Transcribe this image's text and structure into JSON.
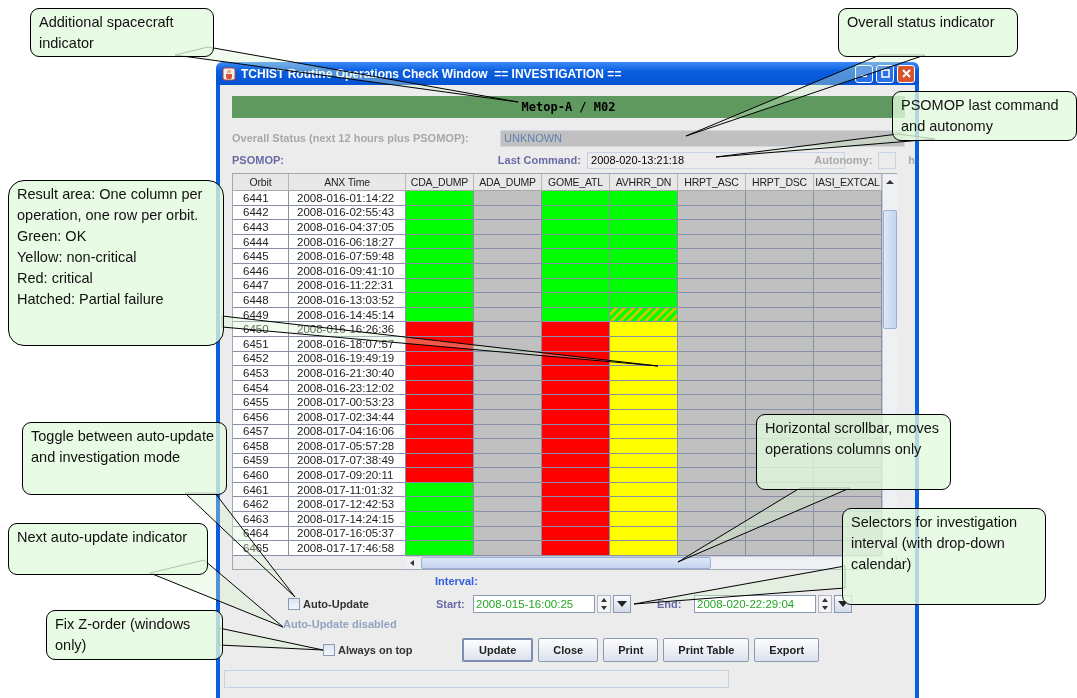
{
  "window": {
    "title": "TCHIST Routine Operations Check Window  == INVESTIGATION =="
  },
  "spacecraft": "Metop-A / M02",
  "overall_status": {
    "label": "Overall Status (next 12 hours plus PSOMOP):",
    "value": "UNKNOWN"
  },
  "psomop": {
    "label": "PSOMOP:",
    "last_command_label": "Last Command:",
    "last_command": "2008-020-13:21:18",
    "autonomy_label": "Autonomy:",
    "autonomy_unit": "h"
  },
  "table": {
    "columns": [
      "Orbit",
      "ANX Time",
      "CDA_DUMP",
      "ADA_DUMP",
      "GOME_ATL",
      "AVHRR_DN",
      "HRPT_ASC",
      "HRPT_DSC",
      "IASI_EXTCAL"
    ],
    "rows": [
      {
        "orbit": "6441",
        "anx_time": "2008-016-01:14:22",
        "cells": [
          {
            "kind": "ok"
          },
          {
            "kind": "none"
          },
          {
            "kind": "ok"
          },
          {
            "kind": "ok"
          },
          {
            "kind": "none"
          },
          {
            "kind": "none"
          },
          {
            "kind": "none"
          }
        ]
      },
      {
        "orbit": "6442",
        "anx_time": "2008-016-02:55:43",
        "cells": [
          {
            "kind": "ok"
          },
          {
            "kind": "none"
          },
          {
            "kind": "ok"
          },
          {
            "kind": "ok"
          },
          {
            "kind": "none"
          },
          {
            "kind": "none"
          },
          {
            "kind": "none"
          }
        ]
      },
      {
        "orbit": "6443",
        "anx_time": "2008-016-04:37:05",
        "cells": [
          {
            "kind": "ok"
          },
          {
            "kind": "none"
          },
          {
            "kind": "ok"
          },
          {
            "kind": "ok"
          },
          {
            "kind": "none"
          },
          {
            "kind": "none"
          },
          {
            "kind": "none"
          }
        ]
      },
      {
        "orbit": "6444",
        "anx_time": "2008-016-06:18:27",
        "cells": [
          {
            "kind": "ok"
          },
          {
            "kind": "none"
          },
          {
            "kind": "ok"
          },
          {
            "kind": "ok"
          },
          {
            "kind": "none"
          },
          {
            "kind": "none"
          },
          {
            "kind": "none"
          }
        ]
      },
      {
        "orbit": "6445",
        "anx_time": "2008-016-07:59:48",
        "cells": [
          {
            "kind": "ok"
          },
          {
            "kind": "none"
          },
          {
            "kind": "ok"
          },
          {
            "kind": "ok"
          },
          {
            "kind": "none"
          },
          {
            "kind": "none"
          },
          {
            "kind": "none"
          }
        ]
      },
      {
        "orbit": "6446",
        "anx_time": "2008-016-09:41:10",
        "cells": [
          {
            "kind": "ok"
          },
          {
            "kind": "none"
          },
          {
            "kind": "ok"
          },
          {
            "kind": "ok"
          },
          {
            "kind": "none"
          },
          {
            "kind": "none"
          },
          {
            "kind": "none"
          }
        ]
      },
      {
        "orbit": "6447",
        "anx_time": "2008-016-11:22:31",
        "cells": [
          {
            "kind": "ok"
          },
          {
            "kind": "none"
          },
          {
            "kind": "ok"
          },
          {
            "kind": "ok"
          },
          {
            "kind": "none"
          },
          {
            "kind": "none"
          },
          {
            "kind": "none"
          }
        ]
      },
      {
        "orbit": "6448",
        "anx_time": "2008-016-13:03:52",
        "cells": [
          {
            "kind": "ok"
          },
          {
            "kind": "none"
          },
          {
            "kind": "ok"
          },
          {
            "kind": "ok"
          },
          {
            "kind": "none"
          },
          {
            "kind": "none"
          },
          {
            "kind": "none"
          }
        ]
      },
      {
        "orbit": "6449",
        "anx_time": "2008-016-14:45:14",
        "cells": [
          {
            "kind": "ok"
          },
          {
            "kind": "none"
          },
          {
            "kind": "ok"
          },
          {
            "kind": "partial"
          },
          {
            "kind": "none"
          },
          {
            "kind": "none"
          },
          {
            "kind": "none"
          }
        ]
      },
      {
        "orbit": "6450",
        "anx_time": "2008-016-16:26:36",
        "cells": [
          {
            "kind": "critical"
          },
          {
            "kind": "none"
          },
          {
            "kind": "critical"
          },
          {
            "kind": "warning"
          },
          {
            "kind": "none"
          },
          {
            "kind": "none"
          },
          {
            "kind": "none"
          }
        ]
      },
      {
        "orbit": "6451",
        "anx_time": "2008-016-18:07:57",
        "cells": [
          {
            "kind": "critical"
          },
          {
            "kind": "none"
          },
          {
            "kind": "critical"
          },
          {
            "kind": "warning"
          },
          {
            "kind": "none"
          },
          {
            "kind": "none"
          },
          {
            "kind": "none"
          }
        ]
      },
      {
        "orbit": "6452",
        "anx_time": "2008-016-19:49:19",
        "cells": [
          {
            "kind": "critical"
          },
          {
            "kind": "none"
          },
          {
            "kind": "critical"
          },
          {
            "kind": "warning"
          },
          {
            "kind": "none"
          },
          {
            "kind": "none"
          },
          {
            "kind": "none"
          }
        ]
      },
      {
        "orbit": "6453",
        "anx_time": "2008-016-21:30:40",
        "cells": [
          {
            "kind": "critical"
          },
          {
            "kind": "none"
          },
          {
            "kind": "critical"
          },
          {
            "kind": "warning"
          },
          {
            "kind": "none"
          },
          {
            "kind": "none"
          },
          {
            "kind": "none"
          }
        ]
      },
      {
        "orbit": "6454",
        "anx_time": "2008-016-23:12:02",
        "cells": [
          {
            "kind": "critical"
          },
          {
            "kind": "none"
          },
          {
            "kind": "critical"
          },
          {
            "kind": "warning"
          },
          {
            "kind": "none"
          },
          {
            "kind": "none"
          },
          {
            "kind": "none"
          }
        ]
      },
      {
        "orbit": "6455",
        "anx_time": "2008-017-00:53:23",
        "cells": [
          {
            "kind": "critical"
          },
          {
            "kind": "none"
          },
          {
            "kind": "critical"
          },
          {
            "kind": "warning"
          },
          {
            "kind": "none"
          },
          {
            "kind": "none"
          },
          {
            "kind": "none"
          }
        ]
      },
      {
        "orbit": "6456",
        "anx_time": "2008-017-02:34:44",
        "cells": [
          {
            "kind": "critical"
          },
          {
            "kind": "none"
          },
          {
            "kind": "critical"
          },
          {
            "kind": "warning"
          },
          {
            "kind": "none"
          },
          {
            "kind": "none"
          },
          {
            "kind": "none"
          }
        ]
      },
      {
        "orbit": "6457",
        "anx_time": "2008-017-04:16:06",
        "cells": [
          {
            "kind": "critical"
          },
          {
            "kind": "none"
          },
          {
            "kind": "critical"
          },
          {
            "kind": "warning"
          },
          {
            "kind": "none"
          },
          {
            "kind": "none"
          },
          {
            "kind": "none"
          }
        ]
      },
      {
        "orbit": "6458",
        "anx_time": "2008-017-05:57:28",
        "cells": [
          {
            "kind": "critical"
          },
          {
            "kind": "none"
          },
          {
            "kind": "critical"
          },
          {
            "kind": "warning"
          },
          {
            "kind": "none"
          },
          {
            "kind": "none"
          },
          {
            "kind": "none"
          }
        ]
      },
      {
        "orbit": "6459",
        "anx_time": "2008-017-07:38:49",
        "cells": [
          {
            "kind": "critical"
          },
          {
            "kind": "none"
          },
          {
            "kind": "critical"
          },
          {
            "kind": "warning"
          },
          {
            "kind": "none"
          },
          {
            "kind": "none"
          },
          {
            "kind": "none"
          }
        ]
      },
      {
        "orbit": "6460",
        "anx_time": "2008-017-09:20:11",
        "cells": [
          {
            "kind": "critical"
          },
          {
            "kind": "none"
          },
          {
            "kind": "critical"
          },
          {
            "kind": "warning"
          },
          {
            "kind": "none"
          },
          {
            "kind": "none"
          },
          {
            "kind": "none"
          }
        ]
      },
      {
        "orbit": "6461",
        "anx_time": "2008-017-11:01:32",
        "cells": [
          {
            "kind": "ok"
          },
          {
            "kind": "none"
          },
          {
            "kind": "critical"
          },
          {
            "kind": "warning"
          },
          {
            "kind": "none"
          },
          {
            "kind": "none"
          },
          {
            "kind": "none"
          }
        ]
      },
      {
        "orbit": "6462",
        "anx_time": "2008-017-12:42:53",
        "cells": [
          {
            "kind": "ok"
          },
          {
            "kind": "none"
          },
          {
            "kind": "critical"
          },
          {
            "kind": "warning"
          },
          {
            "kind": "none"
          },
          {
            "kind": "none"
          },
          {
            "kind": "none"
          }
        ]
      },
      {
        "orbit": "6463",
        "anx_time": "2008-017-14:24:15",
        "cells": [
          {
            "kind": "ok"
          },
          {
            "kind": "none"
          },
          {
            "kind": "critical"
          },
          {
            "kind": "warning"
          },
          {
            "kind": "none"
          },
          {
            "kind": "none"
          },
          {
            "kind": "none"
          }
        ]
      },
      {
        "orbit": "6464",
        "anx_time": "2008-017-16:05:37",
        "cells": [
          {
            "kind": "ok"
          },
          {
            "kind": "none"
          },
          {
            "kind": "critical"
          },
          {
            "kind": "warning"
          },
          {
            "kind": "none"
          },
          {
            "kind": "none"
          },
          {
            "kind": "none"
          }
        ]
      },
      {
        "orbit": "6465",
        "anx_time": "2008-017-17:46:58",
        "cells": [
          {
            "kind": "ok"
          },
          {
            "kind": "none"
          },
          {
            "kind": "critical"
          },
          {
            "kind": "warning"
          },
          {
            "kind": "none"
          },
          {
            "kind": "none"
          },
          {
            "kind": "none"
          }
        ]
      }
    ]
  },
  "interval": {
    "label": "Interval:",
    "start_label": "Start:",
    "start": "2008-015-16:00:25",
    "end_label": "End:",
    "end": "2008-020-22:29:04"
  },
  "auto_update": {
    "label": "Auto-Update",
    "checked": false,
    "status": "Auto-Update disabled"
  },
  "always_on_top": {
    "label": "Always on top",
    "checked": false
  },
  "buttons": [
    {
      "label": "Update",
      "focused": true
    },
    {
      "label": "Close",
      "focused": false
    },
    {
      "label": "Print",
      "focused": false
    },
    {
      "label": "Print Table",
      "focused": false
    },
    {
      "label": "Export",
      "focused": false
    }
  ],
  "callouts": [
    {
      "lines": [
        "Additional spacecraft indicator"
      ]
    },
    {
      "lines": [
        "Overall status indicator"
      ]
    },
    {
      "lines": [
        "PSOMOP last command and autonomy"
      ]
    },
    {
      "lines": [
        "Result area: One column per operation, one row per orbit.",
        "Green: OK",
        "Yellow: non-critical",
        "Red: critical",
        "Hatched: Partial failure"
      ]
    },
    {
      "lines": [
        "Toggle between auto-update and investigation mode"
      ]
    },
    {
      "lines": [
        "Next auto-update indicator"
      ]
    },
    {
      "lines": [
        "Fix Z-order (windows only)"
      ]
    },
    {
      "lines": [
        "Horizontal scrollbar, moves operations columns only"
      ]
    },
    {
      "lines": [
        "Selectors for investigation interval (with drop-down calendar)"
      ]
    }
  ]
}
